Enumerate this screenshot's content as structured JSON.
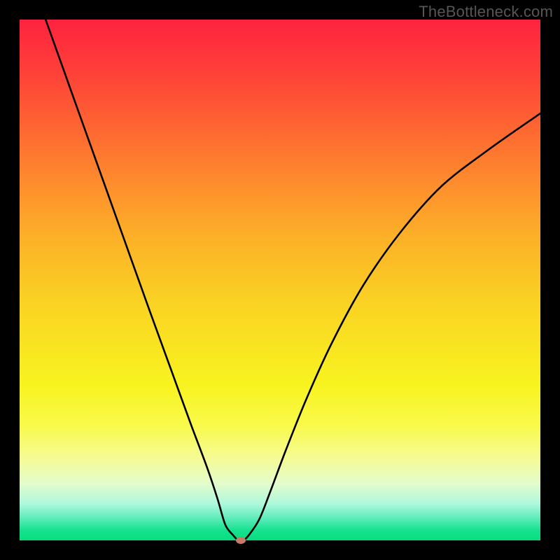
{
  "watermark": "TheBottleneck.com",
  "chart_data": {
    "type": "line",
    "title": "",
    "xlabel": "",
    "ylabel": "",
    "xlim": [
      0,
      100
    ],
    "ylim": [
      0,
      100
    ],
    "series": [
      {
        "name": "bottleneck-curve",
        "x": [
          5,
          10,
          15,
          20,
          25,
          29,
          33,
          36,
          38,
          39.5,
          41,
          42,
          43,
          44,
          46,
          48,
          51,
          55,
          60,
          66,
          73,
          81,
          90,
          100
        ],
        "values": [
          100,
          86,
          72,
          58,
          44,
          33,
          22,
          14,
          8,
          3,
          1,
          0,
          0,
          1,
          4,
          9,
          17,
          27,
          38,
          49,
          59,
          68,
          75,
          82
        ]
      }
    ],
    "marker": {
      "x": 42.5,
      "y": 0
    },
    "gradient_stops": [
      {
        "pos": 0,
        "color": "#FE233F"
      },
      {
        "pos": 10,
        "color": "#FE4038"
      },
      {
        "pos": 22,
        "color": "#FE6A31"
      },
      {
        "pos": 32,
        "color": "#FE8F2D"
      },
      {
        "pos": 42,
        "color": "#FCB127"
      },
      {
        "pos": 55,
        "color": "#FAD423"
      },
      {
        "pos": 70,
        "color": "#F8F31F"
      },
      {
        "pos": 78,
        "color": "#F9FA4B"
      },
      {
        "pos": 84,
        "color": "#F6FB92"
      },
      {
        "pos": 89,
        "color": "#E4FCCB"
      },
      {
        "pos": 93,
        "color": "#AEF8DD"
      },
      {
        "pos": 96,
        "color": "#56EBB6"
      },
      {
        "pos": 98,
        "color": "#17E28F"
      },
      {
        "pos": 100,
        "color": "#06DE7E"
      }
    ]
  }
}
